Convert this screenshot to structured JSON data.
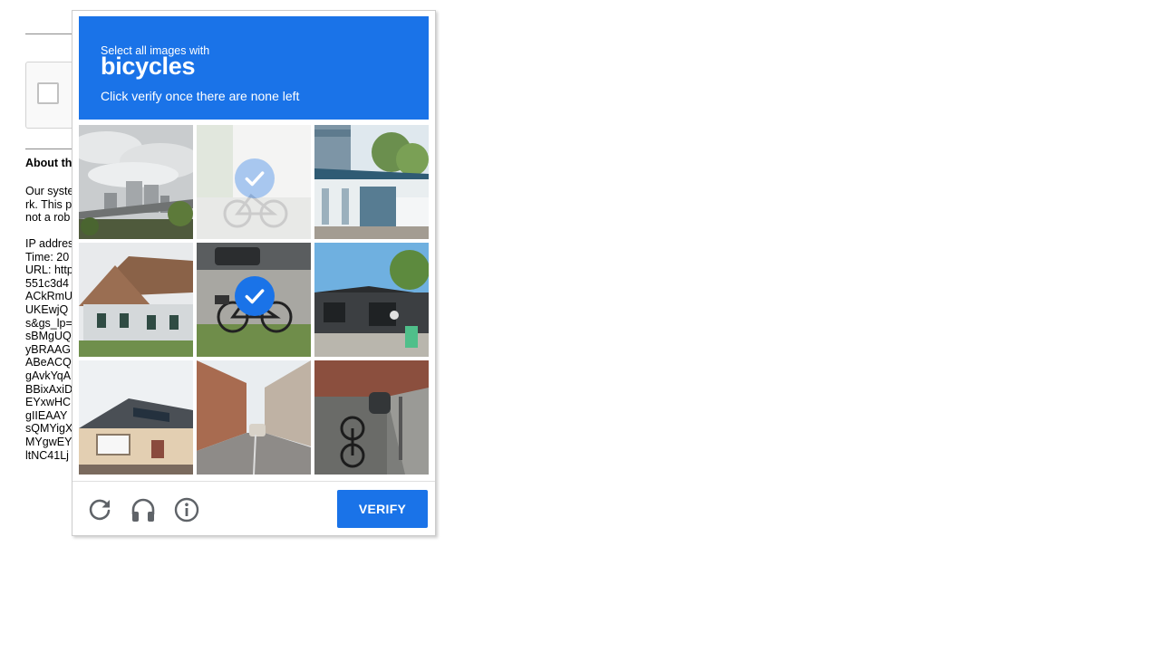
{
  "background_page": {
    "heading": "About th",
    "paragraph1": "Our syste\nrk. This p\nnot a rob",
    "paragraph2": "IP addres\nTime: 20\nURL: http\n551c3d4\nACkRmU\nUKEwjQ\ns&gs_lp=\nsBMgUQ\nyBRAAG\nABeACQ\ngAvkYqA\nBBixAxiD\nEYxwHC\ngIIEAAY\nsQMYigX\nMYgwEY\nltNC41Lj"
  },
  "captcha": {
    "instruction_small": "Select all images with",
    "target": "bicycles",
    "instruction_sub": "Click verify once there are none left",
    "tiles": [
      {
        "scene": "city-skyline-highway",
        "selected": false
      },
      {
        "scene": "bicycle-against-wall",
        "selected": true,
        "fading": true
      },
      {
        "scene": "blue-building-awning",
        "selected": false
      },
      {
        "scene": "house-with-brown-roof",
        "selected": false
      },
      {
        "scene": "bicycle-on-sidewalk",
        "selected": true
      },
      {
        "scene": "dark-shop-building",
        "selected": false
      },
      {
        "scene": "bungalow-solar-panels",
        "selected": false
      },
      {
        "scene": "narrow-street-car",
        "selected": false
      },
      {
        "scene": "bicycles-on-path",
        "selected": false
      }
    ],
    "verify_label": "VERIFY",
    "colors": {
      "accent": "#1a73e8",
      "icon": "#5f6368"
    }
  }
}
